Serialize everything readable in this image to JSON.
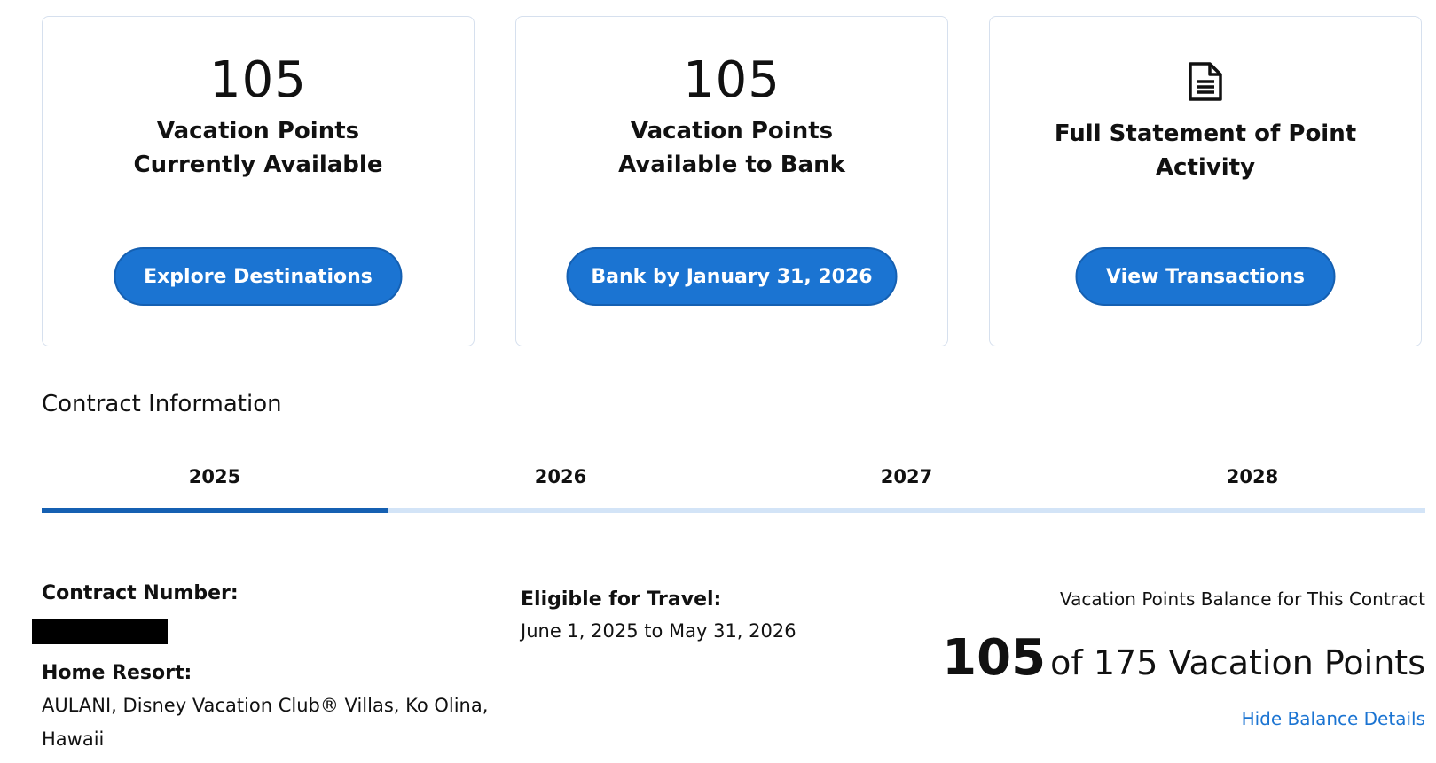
{
  "cards": [
    {
      "number": "105",
      "label_line1": "Vacation Points",
      "label_line2": "Currently Available",
      "button": "Explore Destinations"
    },
    {
      "number": "105",
      "label_line1": "Vacation Points",
      "label_line2": "Available to Bank",
      "button": "Bank by January 31, 2026"
    },
    {
      "icon": "document-icon",
      "label_line1": "Full Statement of Point",
      "label_line2": "Activity",
      "button": "View Transactions"
    }
  ],
  "contract": {
    "section_title": "Contract Information",
    "tabs": [
      "2025",
      "2026",
      "2027",
      "2028"
    ],
    "active_tab": "2025",
    "contract_number_label": "Contract Number:",
    "home_resort_label": "Home Resort:",
    "home_resort_line1": "AULANI, Disney Vacation Club® Villas, Ko Olina,",
    "home_resort_line2": "Hawaii",
    "eligible_label": "Eligible for Travel:",
    "eligible_value": "June 1, 2025 to May 31, 2026",
    "balance_caption": "Vacation Points Balance for This Contract",
    "balance_current": "105",
    "balance_rest": "of 175 Vacation Points",
    "hide_link": "Hide Balance Details"
  },
  "colors": {
    "accent": "#1b74d2",
    "tab_active": "#1560b2",
    "tab_track": "#d3e4f7",
    "card_border": "#d6e0ee"
  }
}
